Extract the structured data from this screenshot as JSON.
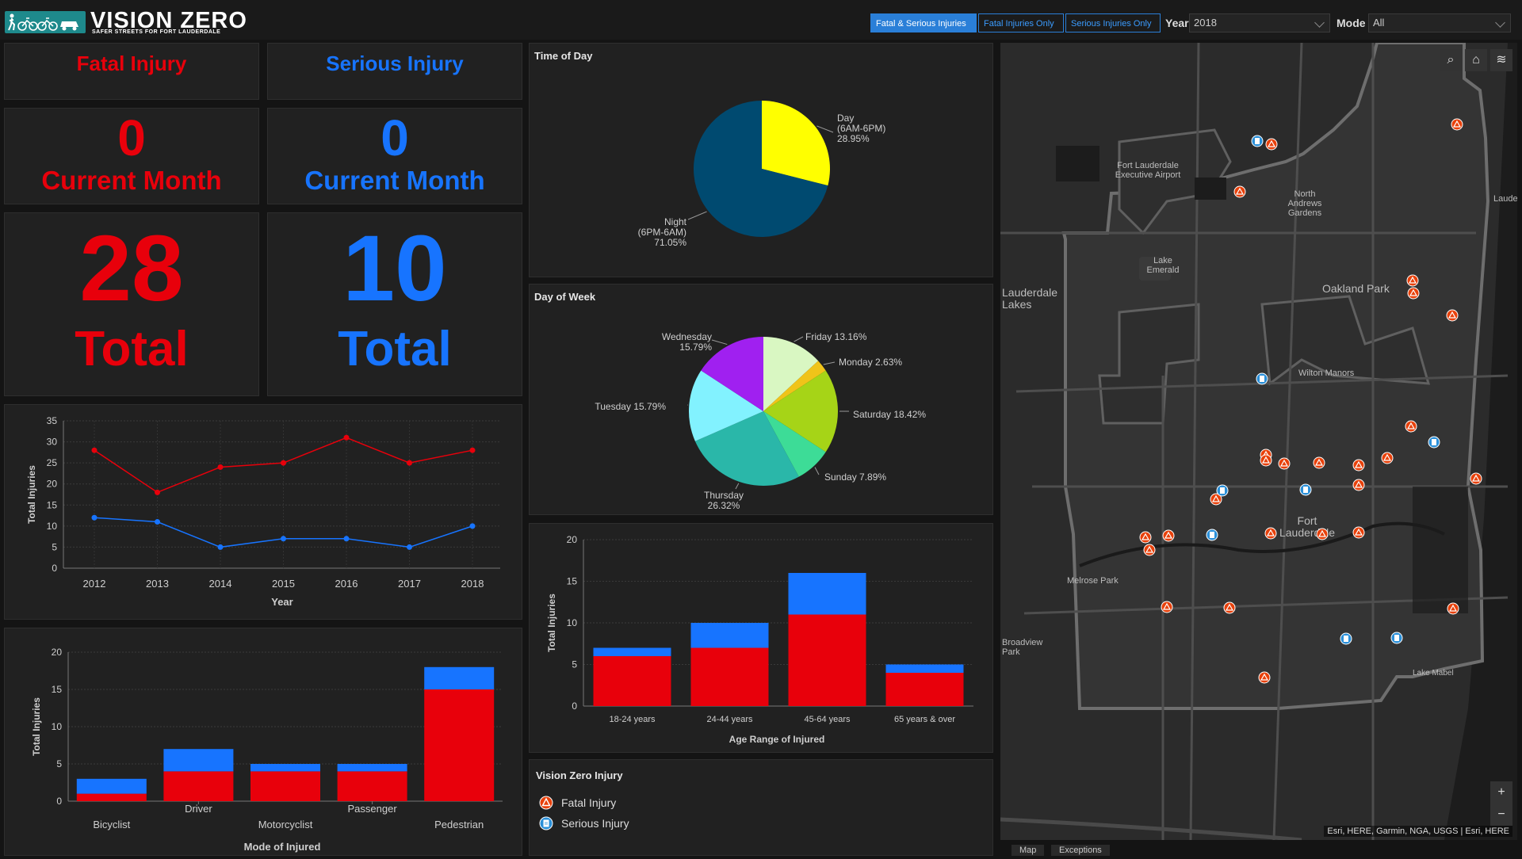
{
  "header": {
    "title": "VISION ZERO",
    "subtitle": "SAFER STREETS FOR FORT LAUDERDALE",
    "filters": [
      "Fatal & Serious Injuries",
      "Fatal Injuries Only",
      "Serious Injuries Only"
    ],
    "year_label": "Year",
    "year_value": "2018",
    "mode_label": "Mode",
    "mode_value": "All"
  },
  "indicators": {
    "fatal_title": "Fatal Injury",
    "serious_title": "Serious Injury",
    "fatal_month_value": "0",
    "serious_month_value": "0",
    "month_label": "Current Month",
    "fatal_total_value": "28",
    "serious_total_value": "10",
    "total_label": "Total"
  },
  "colors": {
    "fatal": "#e8000b",
    "serious": "#1774ff",
    "bg": "#141414",
    "panel": "#212121"
  },
  "chart_data": [
    {
      "id": "trend",
      "type": "line",
      "x": [
        2012,
        2013,
        2014,
        2015,
        2016,
        2017,
        2018
      ],
      "series": [
        {
          "values": [
            28,
            18,
            24,
            25,
            31,
            25,
            28
          ],
          "color": "#e8000b"
        },
        {
          "values": [
            12,
            11,
            5,
            7,
            7,
            5,
            10
          ],
          "color": "#1774ff"
        }
      ],
      "xlabel": "Year",
      "ylabel": "Total Injuries",
      "ylim": [
        0,
        35
      ],
      "yticks": [
        0,
        5,
        10,
        15,
        20,
        25,
        30,
        35
      ],
      "grid": true
    },
    {
      "id": "mode",
      "type": "bar",
      "stacked": true,
      "categories": [
        "Bicyclist",
        "Driver",
        "Motorcyclist",
        "Passenger",
        "Pedestrian"
      ],
      "series": [
        {
          "values": [
            1,
            4,
            4,
            4,
            15
          ],
          "color": "#e8000b"
        },
        {
          "values": [
            2,
            3,
            1,
            1,
            3
          ],
          "color": "#1774ff"
        }
      ],
      "xlabel": "Mode of Injured",
      "ylabel": "Total Injuries",
      "ylim": [
        0,
        20
      ],
      "yticks": [
        0,
        5,
        10,
        15,
        20
      ],
      "grid": true
    },
    {
      "id": "time_of_day",
      "type": "pie",
      "title": "Time of Day",
      "slices": [
        {
          "label": "Day\n(6AM-6PM)\n28.95%",
          "value": 28.95,
          "color": "#ffff00"
        },
        {
          "label": "Night\n(6PM-6AM)\n71.05%",
          "value": 71.05,
          "color": "#004a70"
        }
      ]
    },
    {
      "id": "day_of_week",
      "type": "pie",
      "title": "Day of Week",
      "slices": [
        {
          "label": "Friday 13.16%",
          "value": 13.16,
          "color": "#d9f7c2"
        },
        {
          "label": "Monday 2.63%",
          "value": 2.63,
          "color": "#f0c419"
        },
        {
          "label": "Saturday 18.42%",
          "value": 18.42,
          "color": "#a6d417"
        },
        {
          "label": "Sunday 7.89%",
          "value": 7.89,
          "color": "#3ddc97"
        },
        {
          "label": "Thursday\n26.32%",
          "value": 26.32,
          "color": "#2ab7a9"
        },
        {
          "label": "Tuesday 15.79%",
          "value": 15.79,
          "color": "#82f2ff"
        },
        {
          "label": "Wednesday\n15.79%",
          "value": 15.79,
          "color": "#a020f0"
        }
      ]
    },
    {
      "id": "age",
      "type": "bar",
      "stacked": true,
      "categories": [
        "18-24 years",
        "24-44 years",
        "45-64 years",
        "65 years & over"
      ],
      "series": [
        {
          "values": [
            6,
            7,
            11,
            4
          ],
          "color": "#e8000b"
        },
        {
          "values": [
            1,
            3,
            5,
            1
          ],
          "color": "#1774ff"
        }
      ],
      "xlabel": "Age Range of Injured",
      "ylabel": "Total Injuries",
      "ylim": [
        0,
        20
      ],
      "yticks": [
        0,
        5,
        10,
        15,
        20
      ],
      "grid": true
    }
  ],
  "legend": {
    "title": "Vision Zero Injury",
    "items": [
      {
        "label": "Fatal Injury",
        "color": "#e8410b",
        "icon": "warning-icon"
      },
      {
        "label": "Serious Injury",
        "color": "#2a8fd8",
        "icon": "document-icon"
      }
    ]
  },
  "map": {
    "labels": [
      "Fort Lauderdale\nExecutive Airport",
      "North\nAndrews\nGardens",
      "Lake\nEmerald",
      "Lauderdale\nLakes",
      "Oakland Park",
      "Wilton Manors",
      "Lauderdale-b",
      "Fort\nLauderdale",
      "Melrose Park",
      "Broadview\nPark",
      "Lake Mabel"
    ],
    "attribution": "Esri, HERE, Garmin, NGA, USGS | Esri, HERE",
    "tabs": [
      "Map",
      "Exceptions"
    ]
  }
}
